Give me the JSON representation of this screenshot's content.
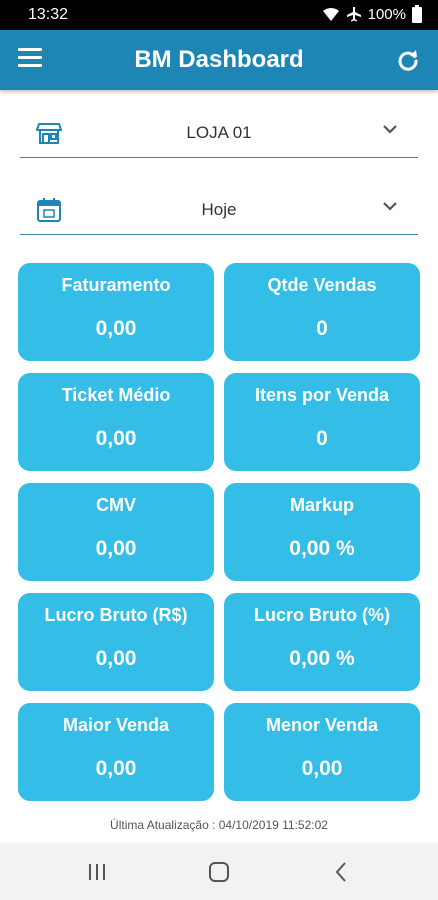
{
  "status_bar": {
    "time": "13:32",
    "battery": "100%"
  },
  "header": {
    "title": "BM Dashboard"
  },
  "filters": {
    "store": "LOJA 01",
    "period": "Hoje"
  },
  "cards": [
    {
      "label": "Faturamento",
      "value": "0,00"
    },
    {
      "label": "Qtde Vendas",
      "value": "0"
    },
    {
      "label": "Ticket Médio",
      "value": "0,00"
    },
    {
      "label": "Itens por Venda",
      "value": "0"
    },
    {
      "label": "CMV",
      "value": "0,00"
    },
    {
      "label": "Markup",
      "value": "0,00 %"
    },
    {
      "label": "Lucro Bruto (R$)",
      "value": "0,00"
    },
    {
      "label": "Lucro Bruto (%)",
      "value": "0,00 %"
    },
    {
      "label": "Maior Venda",
      "value": "0,00"
    },
    {
      "label": "Menor Venda",
      "value": "0,00"
    }
  ],
  "footer": {
    "last_update": "Última Atualização : 04/10/2019   11:52:02"
  },
  "colors": {
    "app_bar": "#1e86b5",
    "card": "#33bde7",
    "divider": "#3a88b0"
  },
  "icons": [
    "wifi-icon",
    "airplane-icon",
    "battery-icon",
    "menu-icon",
    "refresh-icon",
    "store-icon",
    "calendar-icon",
    "chevron-down-icon",
    "recents-icon",
    "home-icon",
    "back-icon"
  ]
}
